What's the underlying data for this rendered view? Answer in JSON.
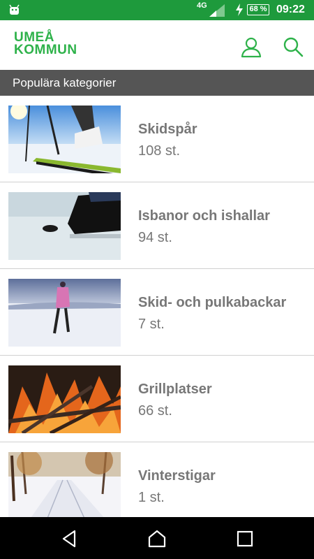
{
  "status_bar": {
    "network": "4G",
    "battery": "68 %",
    "time": "09:22",
    "icons": [
      "android-icon",
      "signal-icon",
      "charging-icon",
      "battery-icon"
    ]
  },
  "app_bar": {
    "logo_line1": "UMEÅ",
    "logo_line2": "KOMMUN",
    "icons": [
      "user-icon",
      "search-icon"
    ],
    "accent_color": "#2eb24a"
  },
  "section": {
    "title": "Populära kategorier"
  },
  "categories": [
    {
      "name": "Skidspår",
      "count": "108 st."
    },
    {
      "name": "Isbanor och ishallar",
      "count": "94 st."
    },
    {
      "name": "Skid- och pulkabackar",
      "count": "7 st."
    },
    {
      "name": "Grillplatser",
      "count": "66 st."
    },
    {
      "name": "Vinterstigar",
      "count": "1 st."
    }
  ],
  "nav_bar": {
    "icons": [
      "back-icon",
      "home-icon",
      "recents-icon"
    ]
  }
}
